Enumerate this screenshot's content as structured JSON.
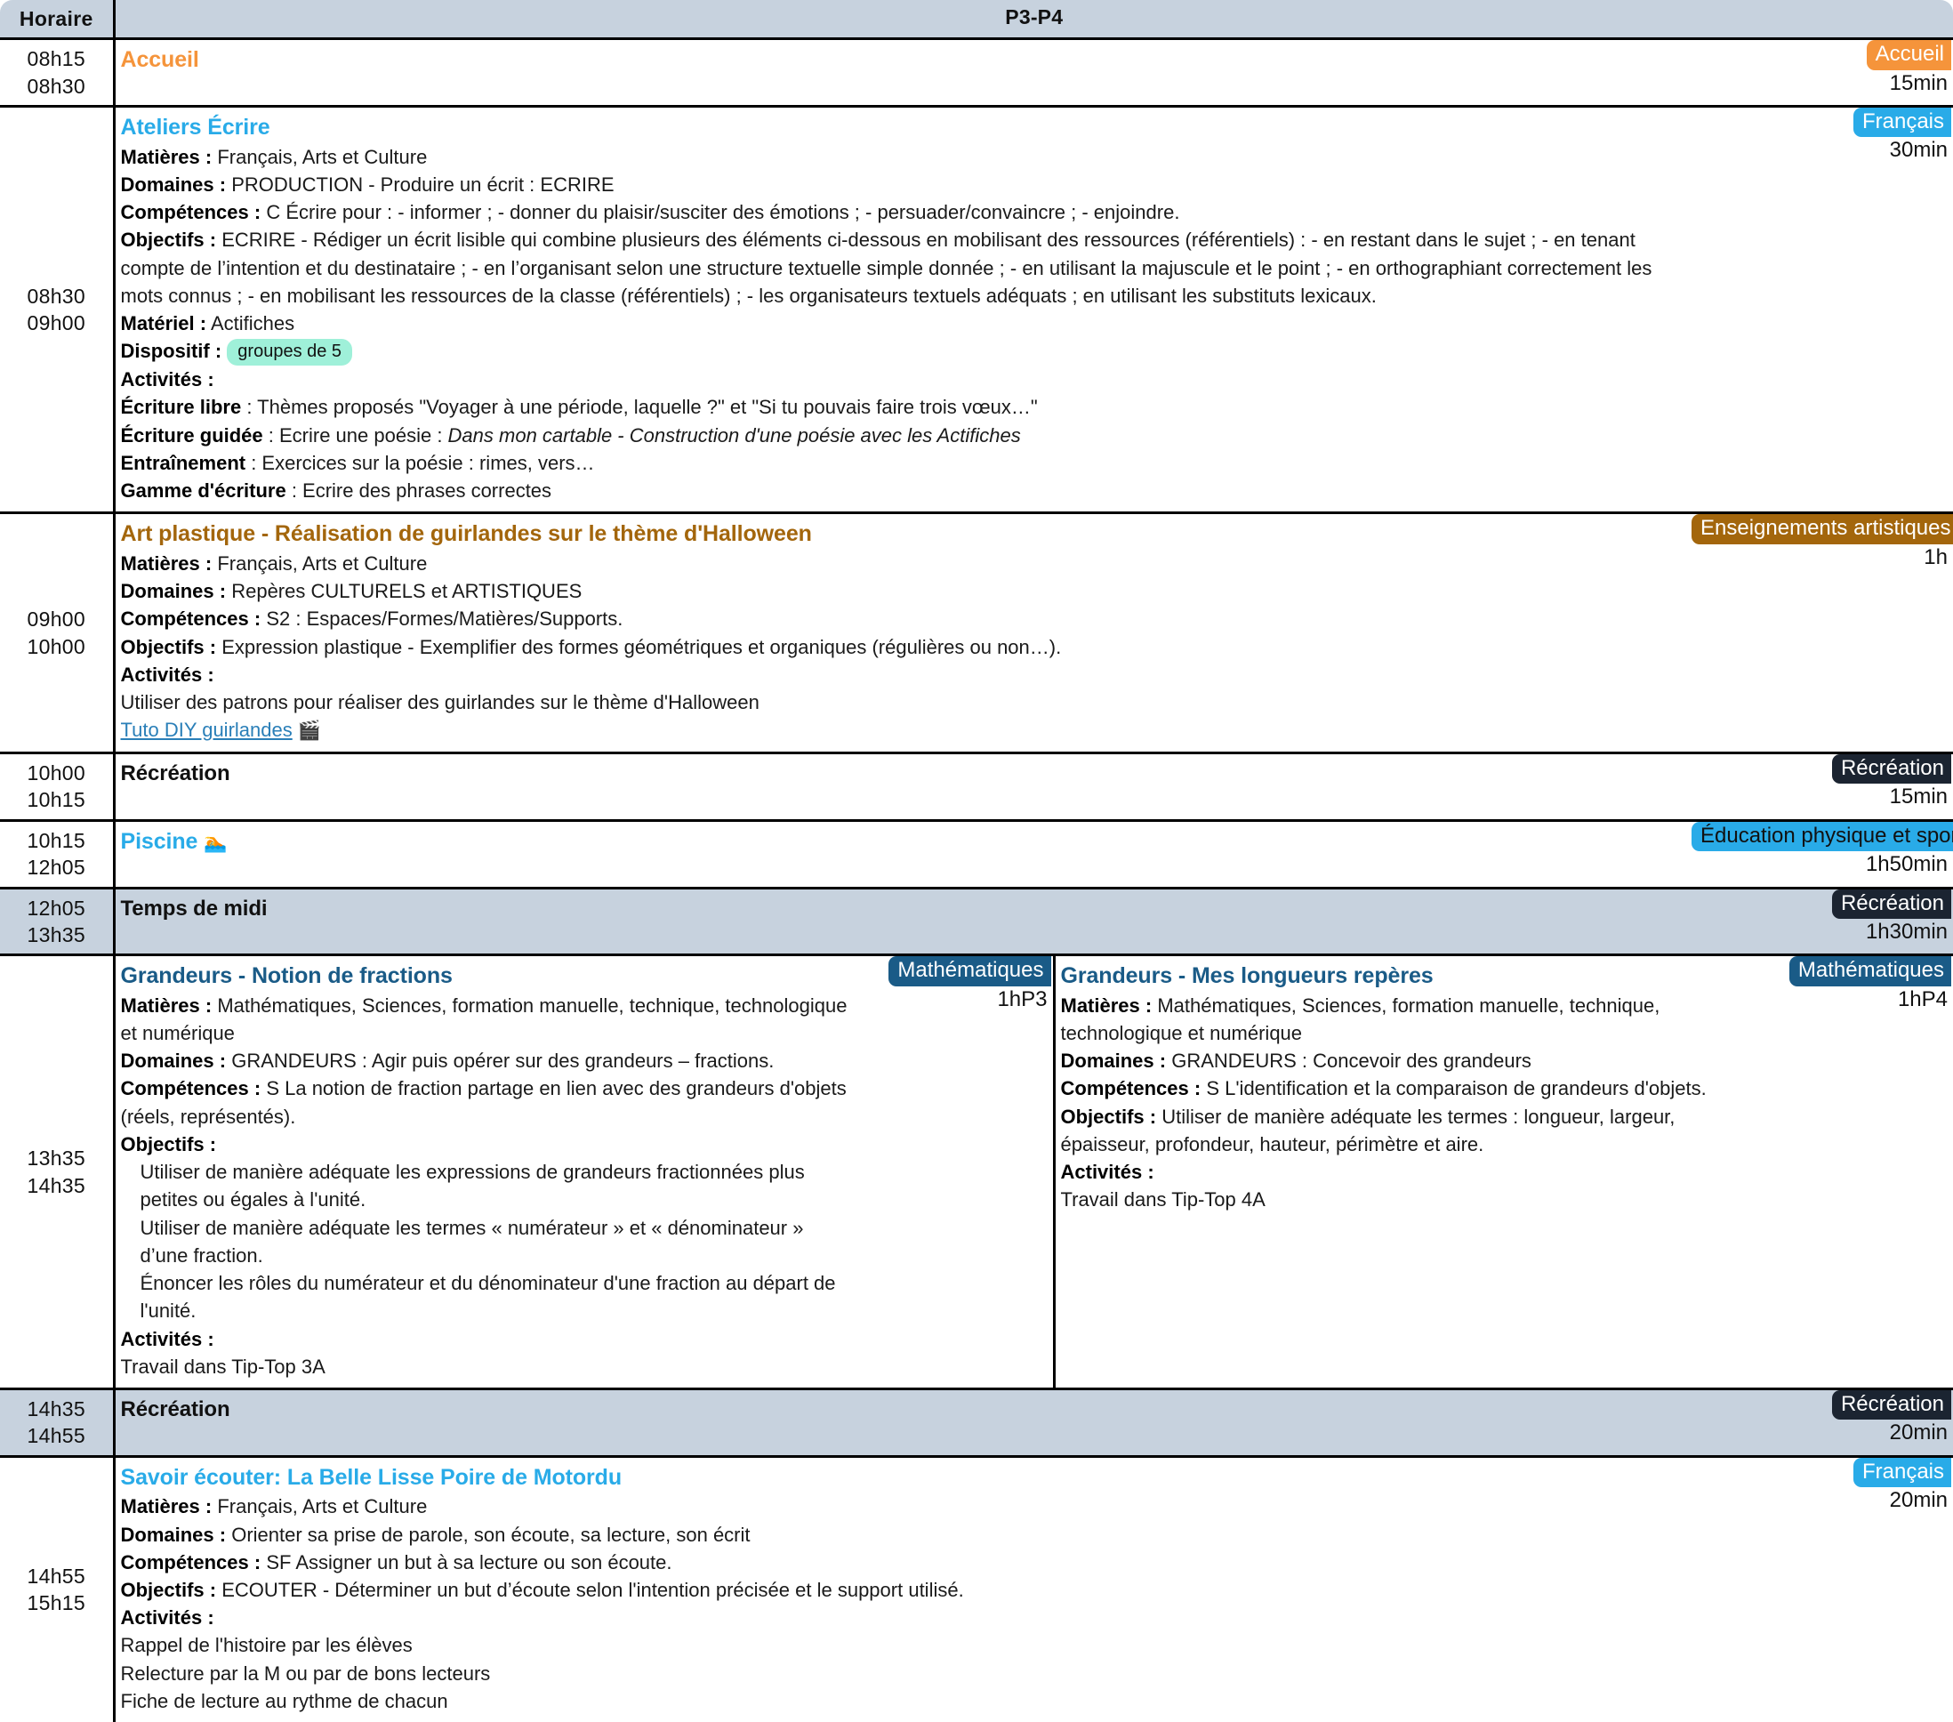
{
  "header": {
    "time_label": "Horaire",
    "class_label": "P3-P4"
  },
  "colors": {
    "accueil_badge": "#F5943B",
    "francais_badge": "#29ABE8",
    "arts_badge": "#A3660C",
    "recreation_badge": "#1B2431",
    "eps_badge": "#29ABE8",
    "maths_badge": "#1A5B87",
    "accueil_title": "#F5943B",
    "francais_title": "#29ABE8",
    "arts_title": "#A3660C",
    "maths_title": "#1A5B87",
    "link": "#2A7FB8",
    "header_bg": "#C7D2DE",
    "dispositif_pill": "#9FF0D9"
  },
  "rows": [
    {
      "start": "08h15",
      "end": "08h30",
      "shaded": false,
      "title": "Accueil",
      "title_style": "accueil",
      "badge": "Accueil",
      "badge_style": "accueil",
      "duration": "15min",
      "lines": []
    },
    {
      "start": "08h30",
      "end": "09h00",
      "shaded": false,
      "title": "Ateliers Écrire",
      "title_style": "francais",
      "badge": "Français",
      "badge_style": "francais",
      "duration": "30min",
      "lines": [
        {
          "label": "Matières :",
          "text": "Français, Arts et Culture"
        },
        {
          "label": "Domaines :",
          "text": "PRODUCTION - Produire un écrit : ECRIRE"
        },
        {
          "label": "Compétences :",
          "text": "C Écrire pour : - informer ; - donner du plaisir/susciter des émotions ; - persuader/convaincre ; - enjoindre."
        },
        {
          "label": "Objectifs :",
          "text": "ECRIRE - Rédiger un écrit lisible qui combine plusieurs des éléments ci-dessous en mobilisant des ressources (référentiels) : - en restant dans le sujet ; - en tenant compte de l’intention et du destinataire ; - en l’organisant selon une structure textuelle simple donnée ; - en utilisant la majuscule et le point ; - en orthographiant correctement les mots connus ; - en mobilisant les ressources de la classe (référentiels) ; - les organisateurs textuels adéquats ; en utilisant les substituts lexicaux."
        },
        {
          "label": "Matériel :",
          "text": "Actifiches"
        },
        {
          "label": "Dispositif :",
          "pill": "groupes de 5"
        },
        {
          "label": "Activités :",
          "text": ""
        },
        {
          "label": "Écriture libre",
          "text": " : Thèmes proposés \"Voyager à une période, laquelle ?\" et \"Si tu pouvais faire trois vœux…\""
        },
        {
          "label": "Écriture guidée",
          "text": " : Ecrire une poésie : ",
          "italic": "Dans mon cartable - Construction d'une poésie avec les Actifiches"
        },
        {
          "label": "Entraînement",
          "text": " : Exercices sur la poésie : rimes, vers…"
        },
        {
          "label": "Gamme d'écriture",
          "text": " : Ecrire des phrases correctes"
        }
      ]
    },
    {
      "start": "09h00",
      "end": "10h00",
      "shaded": false,
      "title": "Art plastique - Réalisation de guirlandes sur le thème d'Halloween",
      "title_style": "arts",
      "badge": "Enseignements artistiques",
      "badge_style": "arts",
      "duration": "1h",
      "lines": [
        {
          "label": "Matières :",
          "text": "Français, Arts et Culture"
        },
        {
          "label": "Domaines :",
          "text": "Repères CULTURELS et ARTISTIQUES"
        },
        {
          "label": "Compétences :",
          "text": "S2 : Espaces/Formes/Matières/Supports."
        },
        {
          "label": "Objectifs :",
          "text": "Expression plastique - Exemplifier des formes géométriques et organiques (régulières ou non…)."
        },
        {
          "label": "Activités :",
          "text": ""
        },
        {
          "label": "",
          "text": "Utiliser des patrons pour réaliser des guirlandes sur le thème d'Halloween"
        },
        {
          "link": "Tuto DIY guirlandes",
          "link_icon": "🎬"
        }
      ]
    },
    {
      "start": "10h00",
      "end": "10h15",
      "shaded": false,
      "title": "Récréation",
      "title_style": "plain",
      "badge": "Récréation",
      "badge_style": "recreation",
      "duration": "15min",
      "lines": []
    },
    {
      "start": "10h15",
      "end": "12h05",
      "shaded": false,
      "title": "Piscine",
      "title_icon": "🏊",
      "title_style": "francais",
      "badge": "Éducation physique et sportive",
      "badge_style": "eps",
      "duration": "1h50min",
      "lines": []
    },
    {
      "start": "12h05",
      "end": "13h35",
      "shaded": true,
      "title": "Temps de midi",
      "title_style": "plain",
      "badge": "Récréation",
      "badge_style": "recreation",
      "duration": "1h30min",
      "lines": []
    },
    {
      "start": "14h35",
      "end": "14h55",
      "shaded": true,
      "title": "Récréation",
      "title_style": "plain",
      "badge": "Récréation",
      "badge_style": "recreation",
      "duration": "20min",
      "lines": []
    },
    {
      "start": "14h55",
      "end": "15h15",
      "shaded": false,
      "title": "Savoir écouter: La Belle Lisse Poire de Motordu",
      "title_style": "francais",
      "badge": "Français",
      "badge_style": "francais",
      "duration": "20min",
      "lines": [
        {
          "label": "Matières :",
          "text": "Français, Arts et Culture"
        },
        {
          "label": "Domaines :",
          "text": "Orienter sa prise de parole, son écoute, sa lecture, son écrit"
        },
        {
          "label": "Compétences :",
          "text": "SF Assigner un but à sa lecture ou son écoute."
        },
        {
          "label": "Objectifs :",
          "text": "ECOUTER - Déterminer un but d’écoute selon l'intention précisée et le support utilisé."
        },
        {
          "label": "Activités :",
          "text": ""
        },
        {
          "label": "",
          "text": "Rappel de l'histoire par les élèves"
        },
        {
          "label": "",
          "text": "Relecture par la M ou par de bons lecteurs"
        },
        {
          "label": "",
          "text": "Fiche de lecture au rythme de chacun"
        }
      ]
    }
  ],
  "split_row": {
    "start": "13h35",
    "end": "14h35",
    "left": {
      "title": "Grandeurs - Notion de fractions",
      "title_style": "maths",
      "badge": "Mathématiques",
      "badge_style": "maths",
      "duration": "1hP3",
      "lines": [
        {
          "label": "Matières :",
          "text": "Mathématiques, Sciences, formation manuelle, technique, technologique et numérique"
        },
        {
          "label": "Domaines :",
          "text": "GRANDEURS : Agir puis opérer sur des grandeurs – fractions."
        },
        {
          "label": "Compétences :",
          "text": "S La notion de fraction partage en lien avec des grandeurs d'objets (réels, représentés)."
        },
        {
          "label": "Objectifs :",
          "text": ""
        },
        {
          "label": "",
          "text": "Utiliser de manière adéquate les expressions de grandeurs fractionnées plus petites ou égales à l'unité.",
          "indent": true
        },
        {
          "label": "",
          "text": "Utiliser de manière adéquate les termes « numérateur » et « dénominateur » d’une fraction.",
          "indent": true
        },
        {
          "label": "",
          "text": "Énoncer les rôles du numérateur et du dénominateur d'une fraction au départ de l'unité.",
          "indent": true
        },
        {
          "label": "Activités :",
          "text": ""
        },
        {
          "label": "",
          "text": "Travail dans Tip-Top 3A"
        }
      ]
    },
    "right": {
      "title": "Grandeurs - Mes longueurs repères",
      "title_style": "maths",
      "badge": "Mathématiques",
      "badge_style": "maths",
      "duration": "1hP4",
      "lines": [
        {
          "label": "Matières :",
          "text": "Mathématiques, Sciences, formation manuelle, technique, technologique et numérique"
        },
        {
          "label": "Domaines :",
          "text": "GRANDEURS : Concevoir des grandeurs"
        },
        {
          "label": "Compétences :",
          "text": "S L'identification et la comparaison de grandeurs d'objets."
        },
        {
          "label": "Objectifs :",
          "text": "Utiliser de manière adéquate les termes : longueur, largeur, épaisseur, profondeur, hauteur, périmètre et aire."
        },
        {
          "label": "Activités :",
          "text": ""
        },
        {
          "label": "",
          "text": "Travail dans Tip-Top 4A"
        }
      ]
    }
  }
}
